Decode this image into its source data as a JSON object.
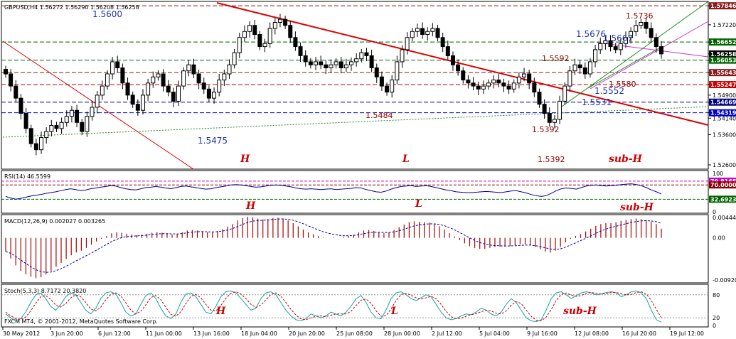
{
  "window": {
    "title": "GBPUSD,H4  1.56272 1.56290 1.56208 1.56258",
    "copyright": "FXCM MT4, © 2001-2012, MetaQuotes Software Corp."
  },
  "chart_data": [
    {
      "type": "candlestick",
      "symbol": "GBPUSD",
      "timeframe": "H4",
      "ohlc_header": "1.56272 1.56290 1.56208 1.56258",
      "y_ticks": [
        "1.57846",
        "1.57220",
        "1.56652",
        "1.56258",
        "1.56053",
        "1.55643",
        "1.55247",
        "1.54900",
        "1.54669",
        "1.54319",
        "1.54140",
        "1.53600",
        "1.52600"
      ],
      "x_ticks": [
        "30 May 2012",
        "3 Jun 20:00",
        "6 Jun 12:00",
        "11 Jun 00:00",
        "13 Jun 16:00",
        "18 Jun 04:00",
        "20 Jun 20:00",
        "25 Jun 08:00",
        "28 Jun 00:00",
        "2 Jul 12:00",
        "5 Jul 04:00",
        "9 Jul 16:00",
        "12 Jul 08:00",
        "16 Jul 20:00",
        "19 Jul 12:00"
      ],
      "price_boxes": [
        {
          "label": "1.57846",
          "color": "#8b1a1a"
        },
        {
          "label": "1.56652",
          "color": "#006400"
        },
        {
          "label": "1.56258",
          "color": "#000000"
        },
        {
          "label": "1.56053",
          "color": "#006400"
        },
        {
          "label": "1.55643",
          "color": "#8b1a1a"
        },
        {
          "label": "1.55247",
          "color": "#cc0000"
        },
        {
          "label": "1.54669",
          "color": "#000080"
        },
        {
          "label": "1.54319",
          "color": "#0000cc"
        }
      ],
      "horizontal_levels": [
        {
          "value": 1.57846,
          "color": "#8b1a1a"
        },
        {
          "value": 1.56652,
          "color": "#006400"
        },
        {
          "value": 1.56053,
          "color": "#006400"
        },
        {
          "value": 1.55643,
          "color": "#8b1a1a"
        },
        {
          "value": 1.55247,
          "color": "#cc0000"
        },
        {
          "value": 1.54669,
          "color": "#000080"
        },
        {
          "value": 1.54319,
          "color": "#0000cc"
        }
      ],
      "close": [
        1.556,
        1.552,
        1.548,
        1.543,
        1.538,
        1.533,
        1.531,
        1.535,
        1.537,
        1.539,
        1.538,
        1.54,
        1.542,
        1.544,
        1.54,
        1.537,
        1.542,
        1.545,
        1.549,
        1.552,
        1.556,
        1.56,
        1.558,
        1.553,
        1.549,
        1.546,
        1.544,
        1.549,
        1.553,
        1.555,
        1.556,
        1.552,
        1.55,
        1.547,
        1.552,
        1.557,
        1.559,
        1.556,
        1.553,
        1.551,
        1.548,
        1.55,
        1.554,
        1.556,
        1.559,
        1.563,
        1.568,
        1.57,
        1.572,
        1.569,
        1.565,
        1.566,
        1.571,
        1.573,
        1.574,
        1.572,
        1.568,
        1.565,
        1.562,
        1.56,
        1.559,
        1.56,
        1.559,
        1.558,
        1.559,
        1.56,
        1.558,
        1.559,
        1.56,
        1.561,
        1.563,
        1.562,
        1.558,
        1.555,
        1.552,
        1.55,
        1.554,
        1.56,
        1.564,
        1.568,
        1.57,
        1.571,
        1.569,
        1.57,
        1.571,
        1.568,
        1.565,
        1.562,
        1.559,
        1.557,
        1.554,
        1.553,
        1.552,
        1.551,
        1.552,
        1.553,
        1.554,
        1.553,
        1.552,
        1.551,
        1.553,
        1.555,
        1.556,
        1.553,
        1.55,
        1.546,
        1.543,
        1.54,
        1.541,
        1.547,
        1.552,
        1.557,
        1.559,
        1.558,
        1.556,
        1.56,
        1.564,
        1.566,
        1.567,
        1.565,
        1.564,
        1.566,
        1.568,
        1.57,
        1.572,
        1.573,
        1.571,
        1.568,
        1.565,
        1.5626
      ],
      "annotations": {
        "blue": [
          "1.5600",
          "1.5475",
          "1.5676",
          "1.5667",
          "1.5552",
          "1.5531"
        ],
        "dark_red": [
          "1.5484",
          "1.5392",
          "1.5392",
          "1.5592",
          "1.5580",
          "1.5736"
        ],
        "pattern": [
          "H",
          "L",
          "sub-H"
        ]
      }
    },
    {
      "type": "line",
      "indicator": "RSI",
      "header": "RSI(14) 46.5599",
      "y_ticks": [
        "100",
        "79.8165",
        "70.0000",
        "32.6923",
        "0"
      ],
      "levels": [
        {
          "value": 79.8165,
          "label": "79.8165",
          "color": "#cc00cc"
        },
        {
          "value": 70.0,
          "label": "70.0000",
          "color": "#8b0000"
        },
        {
          "value": 32.6923,
          "label": "32.6923",
          "color": "#006400"
        }
      ],
      "values": [
        40,
        36,
        33,
        35,
        38,
        41,
        43,
        45,
        48,
        50,
        52,
        55,
        58,
        60,
        58,
        55,
        57,
        60,
        62,
        64,
        66,
        68,
        67,
        63,
        60,
        58,
        57,
        60,
        63,
        64,
        66,
        64,
        62,
        60,
        63,
        66,
        67,
        65,
        63,
        61,
        59,
        60,
        63,
        65,
        67,
        70,
        71,
        70,
        68,
        66,
        64,
        65,
        67,
        69,
        70,
        69,
        67,
        65,
        62,
        60,
        59,
        60,
        59,
        58,
        59,
        60,
        58,
        59,
        60,
        61,
        63,
        62,
        58,
        55,
        52,
        51,
        54,
        59,
        63,
        66,
        67,
        68,
        66,
        67,
        68,
        66,
        63,
        60,
        57,
        55,
        52,
        51,
        50,
        50,
        51,
        52,
        53,
        52,
        51,
        50,
        52,
        54,
        55,
        52,
        49,
        45,
        42,
        40,
        42,
        48,
        55,
        60,
        62,
        61,
        59,
        63,
        67,
        69,
        70,
        68,
        67,
        68,
        69,
        71,
        72,
        73,
        71,
        68,
        63,
        57,
        52,
        46.5599
      ],
      "pattern": [
        "H",
        "L",
        "sub-H"
      ]
    },
    {
      "type": "bar+line",
      "indicator": "MACD",
      "header": "MACD(12,26,9) 0.002027 0.003265",
      "y_ticks": [
        "0.00444",
        "0.00",
        "-0.00920"
      ],
      "histogram": [
        -0.003,
        -0.0045,
        -0.006,
        -0.0072,
        -0.008,
        -0.0085,
        -0.0088,
        -0.0086,
        -0.008,
        -0.0072,
        -0.0063,
        -0.0055,
        -0.0046,
        -0.0038,
        -0.0032,
        -0.0028,
        -0.0022,
        -0.0015,
        -0.0008,
        -0.0002,
        0.0004,
        0.001,
        0.0012,
        0.0011,
        0.0009,
        0.0007,
        0.0006,
        0.0007,
        0.0009,
        0.0011,
        0.0012,
        0.0011,
        0.0009,
        0.0007,
        0.0008,
        0.0012,
        0.0016,
        0.0017,
        0.0016,
        0.0014,
        0.0012,
        0.0012,
        0.0015,
        0.0019,
        0.0024,
        0.003,
        0.0038,
        0.0043,
        0.0046,
        0.0045,
        0.0042,
        0.004,
        0.0041,
        0.0043,
        0.0044,
        0.0042,
        0.0038,
        0.0032,
        0.0025,
        0.0018,
        0.0012,
        0.0008,
        0.0004,
        0.0001,
        0.0,
        0.0001,
        0.0,
        0.0002,
        0.0004,
        0.0007,
        0.0012,
        0.0016,
        0.0017,
        0.0015,
        0.0012,
        0.001,
        0.0012,
        0.0017,
        0.0023,
        0.0029,
        0.0034,
        0.0036,
        0.0035,
        0.0034,
        0.0033,
        0.003,
        0.0025,
        0.0018,
        0.001,
        0.0003,
        -0.0005,
        -0.0012,
        -0.0018,
        -0.0022,
        -0.0024,
        -0.0024,
        -0.0022,
        -0.002,
        -0.0019,
        -0.0019,
        -0.0018,
        -0.0016,
        -0.0014,
        -0.0014,
        -0.0016,
        -0.002,
        -0.0025,
        -0.003,
        -0.0032,
        -0.0028,
        -0.002,
        -0.001,
        -0.0002,
        0.0004,
        0.0008,
        0.0014,
        0.002,
        0.0026,
        0.003,
        0.0032,
        0.0032,
        0.0034,
        0.0037,
        0.0039,
        0.0041,
        0.0042,
        0.0041,
        0.0039,
        0.0035,
        0.003,
        0.002
      ],
      "pattern": [
        "H",
        "L",
        "sub-H"
      ]
    },
    {
      "type": "line",
      "indicator": "Stochastic",
      "header": "Stoch(5,3,3) 8.7172 20.3820",
      "y_ticks": [
        "80",
        "20",
        "0"
      ],
      "main": [
        30,
        20,
        12,
        18,
        35,
        60,
        80,
        85,
        70,
        50,
        40,
        55,
        75,
        85,
        80,
        60,
        40,
        30,
        45,
        70,
        85,
        88,
        82,
        60,
        35,
        25,
        30,
        55,
        78,
        85,
        70,
        45,
        25,
        18,
        30,
        60,
        82,
        85,
        75,
        55,
        35,
        30,
        50,
        75,
        88,
        90,
        85,
        70,
        55,
        40,
        45,
        70,
        85,
        88,
        80,
        60,
        40,
        25,
        15,
        12,
        18,
        30,
        25,
        20,
        25,
        35,
        30,
        25,
        35,
        50,
        70,
        78,
        60,
        35,
        20,
        18,
        40,
        70,
        85,
        88,
        80,
        70,
        65,
        72,
        80,
        75,
        55,
        35,
        20,
        15,
        18,
        25,
        30,
        28,
        35,
        45,
        40,
        30,
        25,
        35,
        55,
        70,
        60,
        40,
        20,
        12,
        10,
        15,
        40,
        70,
        85,
        88,
        80,
        70,
        78,
        85,
        88,
        85,
        80,
        82,
        86,
        88,
        85,
        75,
        80,
        88,
        90,
        85,
        70,
        40,
        15,
        8.7172
      ],
      "signal": [
        35,
        25,
        18,
        16,
        22,
        38,
        58,
        75,
        78,
        68,
        53,
        48,
        57,
        72,
        80,
        75,
        60,
        43,
        38,
        48,
        67,
        81,
        85,
        77,
        59,
        40,
        30,
        37,
        54,
        73,
        78,
        67,
        47,
        29,
        24,
        36,
        57,
        76,
        81,
        72,
        55,
        40,
        38,
        52,
        71,
        84,
        88,
        82,
        70,
        55,
        47,
        53,
        67,
        81,
        85,
        76,
        60,
        42,
        27,
        17,
        15,
        20,
        24,
        25,
        23,
        27,
        30,
        30,
        30,
        37,
        52,
        66,
        69,
        58,
        38,
        24,
        26,
        43,
        65,
        81,
        84,
        79,
        72,
        69,
        72,
        76,
        70,
        55,
        37,
        23,
        18,
        19,
        24,
        28,
        31,
        36,
        40,
        38,
        32,
        30,
        38,
        53,
        62,
        57,
        40,
        24,
        14,
        12,
        22,
        42,
        65,
        81,
        85,
        79,
        76,
        78,
        84,
        86,
        84,
        82,
        83,
        86,
        86,
        83,
        80,
        81,
        86,
        88,
        82,
        65,
        42,
        20.382
      ],
      "pattern": []
    }
  ],
  "colors": {
    "bull_candle": "#ffffff",
    "bear_candle": "#000000",
    "trend_red": "#dd0000",
    "trend_green": "#228b22",
    "trend_magenta": "#cc33cc",
    "rsi_line": "#000099",
    "macd_hist": "#aa0000",
    "stoch_main": "#1aa3a3",
    "stoch_signal": "#cc0000"
  }
}
